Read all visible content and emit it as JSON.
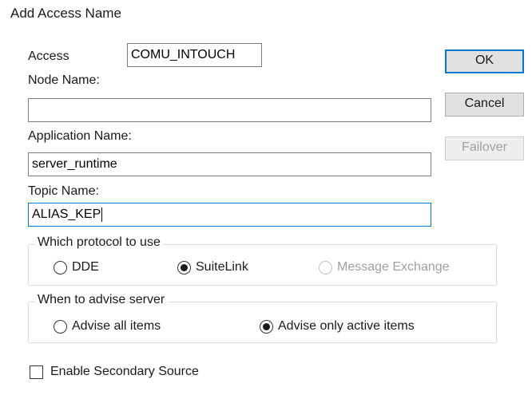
{
  "dialog": {
    "title": "Add Access Name"
  },
  "fields": {
    "access_label": "Access",
    "access_value": "COMU_INTOUCH",
    "node_label": "Node Name:",
    "node_value": "",
    "application_label": "Application Name:",
    "application_value": "server_runtime",
    "topic_label": "Topic Name:",
    "topic_value": "ALIAS_KEP"
  },
  "buttons": {
    "ok": "OK",
    "cancel": "Cancel",
    "failover": "Failover"
  },
  "protocol": {
    "legend": "Which protocol to use",
    "options": [
      "DDE",
      "SuiteLink",
      "Message Exchange"
    ],
    "selected": "SuiteLink"
  },
  "advise": {
    "legend": "When to advise server",
    "options": [
      "Advise all items",
      "Advise only active items"
    ],
    "selected": "Advise only active items"
  },
  "secondary": {
    "label": "Enable Secondary Source",
    "checked": false
  },
  "colors": {
    "focus_border": "#0078d7",
    "button_face": "#e1e1e1",
    "disabled_text": "#a0a0a0"
  }
}
